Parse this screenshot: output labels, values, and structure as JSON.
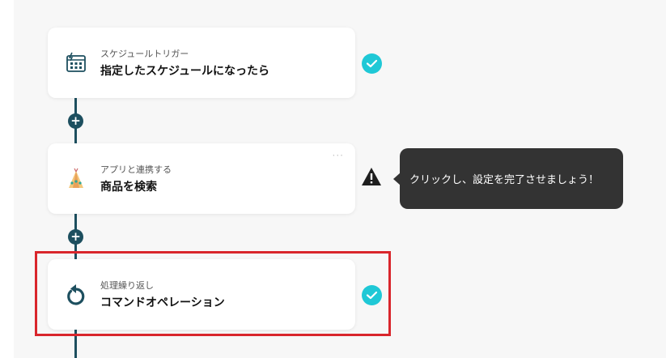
{
  "flow": {
    "steps": [
      {
        "type_label": "スケジュールトリガー",
        "title": "指定したスケジュールになったら",
        "icon": "schedule-trigger-icon",
        "status": "complete"
      },
      {
        "type_label": "アプリと連携する",
        "title": "商品を検索",
        "icon": "tent-app-icon",
        "status": "warning",
        "menu_glyph": "···"
      },
      {
        "type_label": "処理繰り返し",
        "title": "コマンドオペレーション",
        "icon": "repeat-icon",
        "status": "complete"
      }
    ],
    "add_step_glyph": "+"
  },
  "tooltip": {
    "text": "クリックし、設定を完了させましょう！"
  },
  "colors": {
    "connector": "#1d4f5f",
    "check": "#1fc8d6",
    "tooltip_bg": "#333333",
    "highlight": "#d9262c",
    "canvas_bg": "#f7f7f7"
  }
}
